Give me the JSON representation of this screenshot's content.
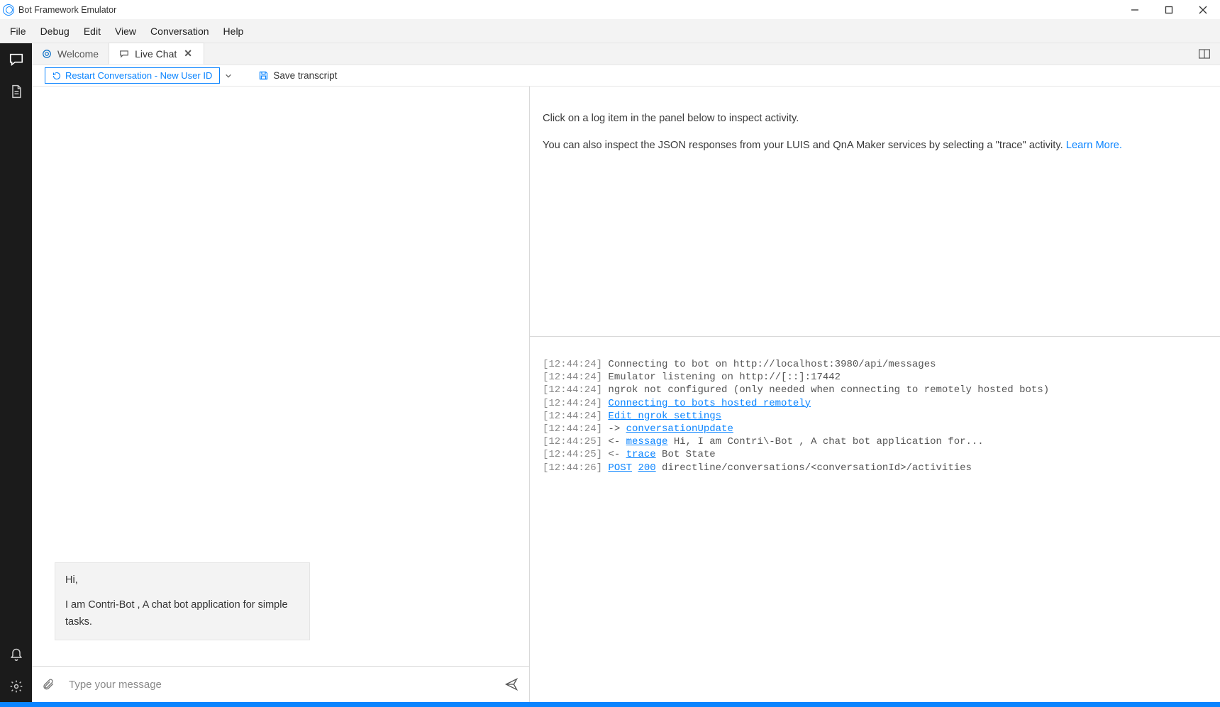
{
  "titlebar": {
    "title": "Bot Framework Emulator"
  },
  "menu": {
    "items": [
      "File",
      "Debug",
      "Edit",
      "View",
      "Conversation",
      "Help"
    ]
  },
  "tabs": {
    "items": [
      {
        "label": "Welcome",
        "active": false,
        "icon": "bot"
      },
      {
        "label": "Live Chat",
        "active": true,
        "icon": "chat"
      }
    ]
  },
  "toolbar": {
    "restart_label": "Restart Conversation - New User ID",
    "save_label": "Save transcript"
  },
  "chat": {
    "bubble_line1": "Hi,",
    "bubble_line2": "I am Contri-Bot , A chat bot application for simple tasks.",
    "compose_placeholder": "Type your message"
  },
  "inspector": {
    "hint1": "Click on a log item in the panel below to inspect activity.",
    "hint2": "You can also inspect the JSON responses from your LUIS and QnA Maker services by selecting a \"trace\" activity. ",
    "learn_more": "Learn More."
  },
  "log": {
    "lines": [
      {
        "ts": "[12:44:24]",
        "parts": [
          {
            "t": "txt",
            "v": " Connecting to bot on http://localhost:3980/api/messages"
          }
        ]
      },
      {
        "ts": "[12:44:24]",
        "parts": [
          {
            "t": "txt",
            "v": " Emulator listening on http://[::]:17442"
          }
        ]
      },
      {
        "ts": "[12:44:24]",
        "parts": [
          {
            "t": "txt",
            "v": " ngrok not configured (only needed when connecting to remotely hosted bots)"
          }
        ]
      },
      {
        "ts": "[12:44:24]",
        "parts": [
          {
            "t": "txt",
            "v": " "
          },
          {
            "t": "link",
            "v": "Connecting to bots hosted remotely"
          }
        ]
      },
      {
        "ts": "[12:44:24]",
        "parts": [
          {
            "t": "txt",
            "v": " "
          },
          {
            "t": "link",
            "v": "Edit ngrok settings"
          }
        ]
      },
      {
        "ts": "[12:44:24]",
        "parts": [
          {
            "t": "txt",
            "v": " -> "
          },
          {
            "t": "link",
            "v": "conversationUpdate"
          }
        ]
      },
      {
        "ts": "[12:44:25]",
        "parts": [
          {
            "t": "txt",
            "v": " <- "
          },
          {
            "t": "link",
            "v": "message"
          },
          {
            "t": "txt",
            "v": " Hi, I am Contri\\-Bot , A chat bot application for..."
          }
        ]
      },
      {
        "ts": "[12:44:25]",
        "parts": [
          {
            "t": "txt",
            "v": " <- "
          },
          {
            "t": "link",
            "v": "trace"
          },
          {
            "t": "txt",
            "v": " Bot State"
          }
        ]
      },
      {
        "ts": "[12:44:26]",
        "parts": [
          {
            "t": "txt",
            "v": " "
          },
          {
            "t": "link",
            "v": "POST"
          },
          {
            "t": "txt",
            "v": " "
          },
          {
            "t": "link",
            "v": "200"
          },
          {
            "t": "txt",
            "v": " directline/conversations/<conversationId>/activities"
          }
        ]
      }
    ]
  }
}
